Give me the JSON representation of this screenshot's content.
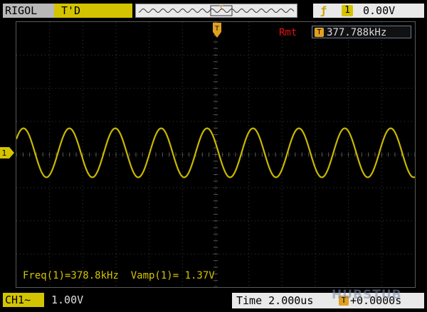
{
  "header": {
    "brand": "RIGOL",
    "run_state": "T'D",
    "trigger_marker": "T"
  },
  "trigger": {
    "slope_icon": "rising-edge-icon",
    "source": "1",
    "level": "0.00V"
  },
  "screen": {
    "rmt_label": "Rmt",
    "freq_icon": "T",
    "trigger_frequency": "377.788kHz",
    "channel_marker": "1",
    "trace_color": "#c8b800",
    "grid_color": "#3c3c3c"
  },
  "measurements": "Freq(1)=378.8kHz  Vamp(1)= 1.37V",
  "footer": {
    "channel_label": "CH1",
    "coupling_icon": "~",
    "volts_per_div": "1.00V",
    "time_label": "Time 2.000us",
    "offset_icon": "T",
    "trigger_offset": "+0.0000s"
  },
  "watermark": "HUBSTUB"
}
